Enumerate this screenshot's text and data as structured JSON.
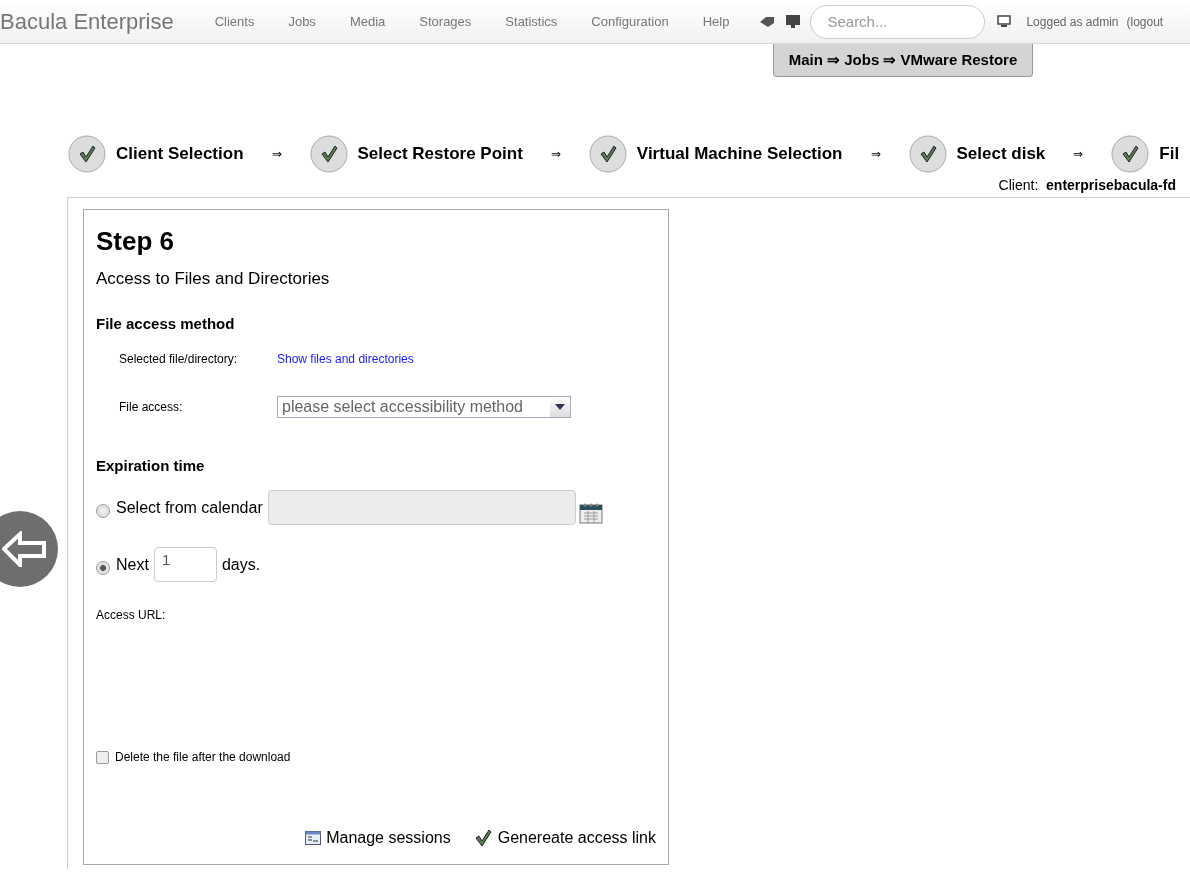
{
  "header": {
    "brand": "Bacula Enterprise",
    "nav": [
      "Clients",
      "Jobs",
      "Media",
      "Storages",
      "Statistics",
      "Configuration",
      "Help"
    ],
    "search": {
      "placeholder": "Search..."
    },
    "user": "Logged as admin",
    "logout": "(logout"
  },
  "breadcrumb": "Main ⇒ Jobs ⇒ VMware Restore",
  "steps": [
    {
      "label": "Client Selection",
      "done": true,
      "arrow": "⇒"
    },
    {
      "label": "Select Restore Point",
      "done": true,
      "arrow": "⇒"
    },
    {
      "label": "Virtual Machine Selection",
      "done": true,
      "arrow": "⇒"
    },
    {
      "label": "Select disk",
      "done": true,
      "arrow": "⇒"
    },
    {
      "label": "Fil",
      "done": true
    }
  ],
  "client": {
    "label": "Client:",
    "value": "enterprisebacula-fd"
  },
  "step": {
    "title": "Step 6",
    "subtitle": "Access to Files and Directories"
  },
  "file_access": {
    "heading": "File access method",
    "selected_label": "Selected file/directory:",
    "link": "Show files and directories",
    "access_label": "File access:",
    "select": {
      "placeholder": "please select accessibility method"
    }
  },
  "expiration": {
    "heading": "Expiration time",
    "options": [
      {
        "kind": "calendar",
        "label": "Select from calendar",
        "selected": false
      },
      {
        "kind": "days",
        "label": "Next",
        "value": "1",
        "suffix": "days.",
        "selected": true
      }
    ]
  },
  "access_url": {
    "label": "Access URL:"
  },
  "delete_after": {
    "label": "Delete the file after the download",
    "checked": false
  },
  "actions": [
    {
      "kind": "sessions",
      "label": "Manage sessions"
    },
    {
      "kind": "generate",
      "label": "Genereate access link"
    }
  ]
}
